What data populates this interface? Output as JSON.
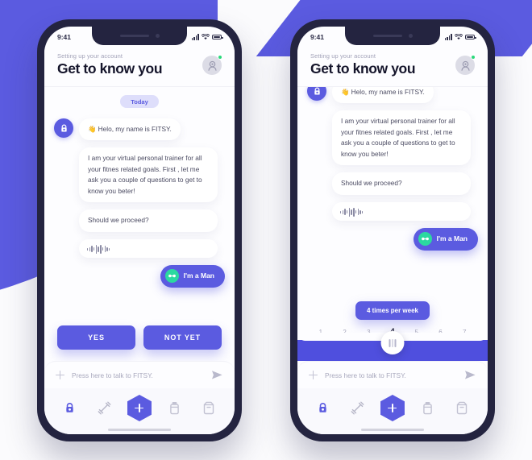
{
  "theme": {
    "accent": "#5b5be0",
    "accent_dark": "#4f4fde",
    "frame": "#242440",
    "online_dot": "#2bd97b",
    "gender_icon_bg": "#2bd9a0",
    "pill_bg": "#dedefb",
    "page_bg": "#fbfbfd"
  },
  "status_bar": {
    "time": "9:41",
    "signal_icon": "signal-bars-icon",
    "wifi_icon": "wifi-icon",
    "battery_icon": "battery-icon"
  },
  "header": {
    "subtitle": "Setting up your account",
    "title": "Get to know you",
    "avatar_icon": "user-avatar-icon",
    "online_badge": "online-status-dot"
  },
  "chat": {
    "day_label": "Today",
    "bot_avatar_icon": "kettlebell-bot-avatar-icon",
    "messages": [
      {
        "id": "greeting",
        "from": "bot",
        "text": "👋  Helo, my name is FITSY."
      },
      {
        "id": "intro",
        "from": "bot",
        "text": "I am your virtual personal trainer for all your fitnes related goals. First , let me ask you a couple of questions to get to know you beter!"
      },
      {
        "id": "proceed",
        "from": "bot",
        "text": "Should we proceed?"
      },
      {
        "id": "voice-note",
        "from": "bot",
        "type": "voice",
        "text": ""
      },
      {
        "id": "gender-reply",
        "from": "user",
        "text": "I'm a Man",
        "icon": "gender-male-icon"
      }
    ]
  },
  "actions": {
    "yes_label": "YES",
    "not_yet_label": "NOT YET"
  },
  "slider": {
    "tooltip": "4 times per week",
    "ticks": [
      "1",
      "2",
      "3",
      "4",
      "5",
      "6",
      "7"
    ],
    "value": "4",
    "min": "1",
    "max": "7",
    "handle_icon": "slider-grip-icon"
  },
  "input_bar": {
    "placeholder": "Press here to talk to FITSY.",
    "plus_icon": "add-attachment-icon",
    "send_icon": "send-icon"
  },
  "nav": {
    "items": [
      {
        "id": "workouts",
        "icon": "kettlebell-icon",
        "active": true
      },
      {
        "id": "exercises",
        "icon": "dumbbell-icon",
        "active": false
      },
      {
        "id": "add",
        "icon": "plus-hexagon-icon",
        "active": false
      },
      {
        "id": "supplements",
        "icon": "supplement-bottle-icon",
        "active": false
      },
      {
        "id": "nutrition",
        "icon": "lunch-bag-icon",
        "active": false
      }
    ]
  },
  "home_indicator": "home-indicator-bar"
}
